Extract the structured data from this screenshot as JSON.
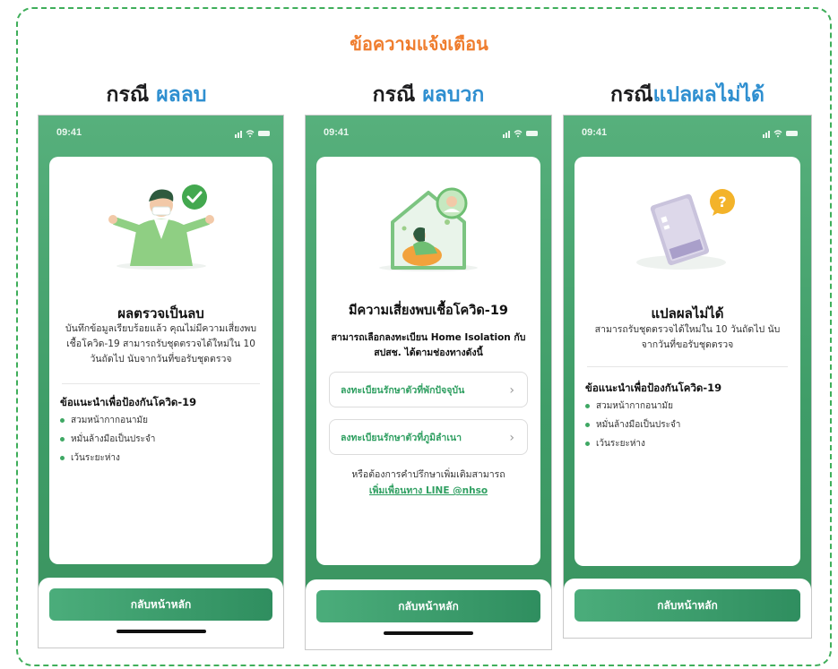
{
  "page_title": "ข้อความแจ้งเตือน",
  "columns": [
    {
      "title_prefix": "กรณี",
      "title_highlight": "ผลลบ",
      "status_time": "09:41",
      "card_title": "ผลตรวจเป็นลบ",
      "card_body": "บันทึกข้อมูลเรียบร้อยแล้ว คุณไม่มีความเสี่ยงพบเชื้อโควิด-19 สามารถรับชุดตรวจได้ใหม่ใน 10 วันถัดไป นับจากวันที่ขอรับชุดตรวจ",
      "advice_title": "ข้อแนะนำเพื่อป้องกันโควิด-19",
      "tips": [
        "สวมหน้ากากอนามัย",
        "หมั่นล้างมือเป็นประจำ",
        "เว้นระยะห่าง"
      ],
      "home_button": "กลับหน้าหลัก"
    },
    {
      "title_prefix": "กรณี",
      "title_highlight": "ผลบวก",
      "status_time": "09:41",
      "card_title": "มีความเสี่ยงพบเชื้อโควิด-19",
      "card_subtitle": "สามารถเลือกลงทะเบียน Home Isolation กับ สปสช. ได้ตามช่องทางดังนี้",
      "options": [
        "ลงทะเบียนรักษาตัวที่พักปัจจุบัน",
        "ลงทะเบียนรักษาตัวที่ภูมิลำเนา"
      ],
      "consult_text": "หรือต้องการคำปรึกษาเพิ่มเติมสามารถ",
      "consult_link": "เพิ่มเพื่อนทาง LINE @nhso",
      "home_button": "กลับหน้าหลัก"
    },
    {
      "title_prefix": "กรณี",
      "title_highlight": "แปลผลไม่ได้",
      "status_time": "09:41",
      "card_title": "แปลผลไม่ได้",
      "card_body": "สามารถรับชุดตรวจได้ใหม่ใน 10 วันถัดไป นับจากวันที่ขอรับชุดตรวจ",
      "advice_title": "ข้อแนะนำเพื่อป้องกันโควิด-19",
      "tips": [
        "สวมหน้ากากอนามัย",
        "หมั่นล้างมือเป็นประจำ",
        "เว้นระยะห่าง"
      ],
      "home_button": "กลับหน้าหลัก"
    }
  ],
  "colors": {
    "accent_orange": "#ef7d2e",
    "accent_blue": "#2f8fd0",
    "brand_green": "#3f9d68",
    "border_dashed": "#3fae5a"
  },
  "icons": {
    "check": "check-circle-icon",
    "question": "question-bubble-icon",
    "chevron": "chevron-right-icon",
    "signal": "signal-icon",
    "wifi": "wifi-icon",
    "battery": "battery-icon"
  }
}
